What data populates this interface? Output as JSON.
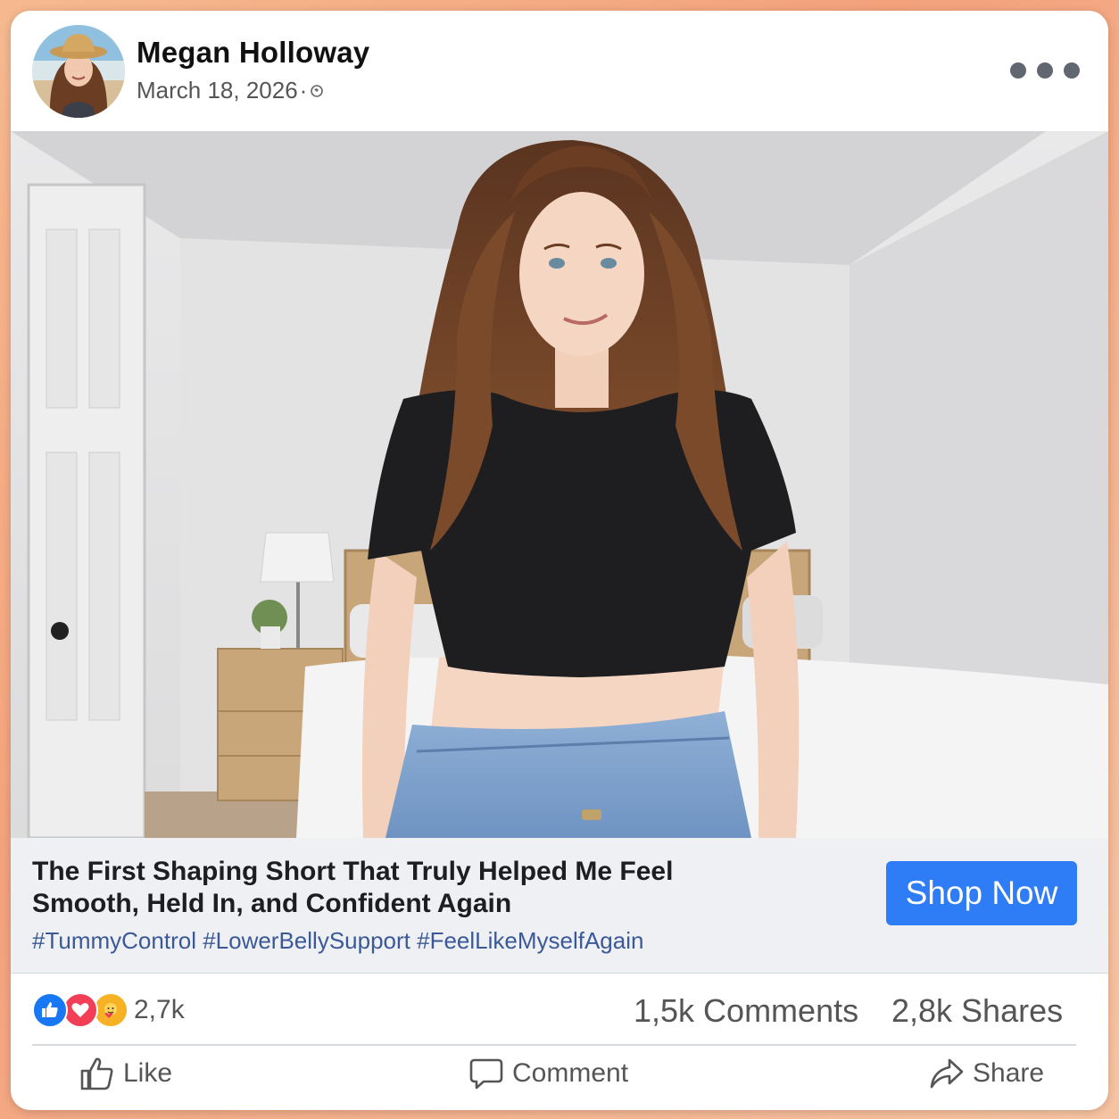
{
  "post": {
    "author": "Megan Holloway",
    "date": "March 18, 2026",
    "date_separator": "·",
    "privacy_icon": "globe-icon",
    "more_icon": "more-options-icon"
  },
  "ad": {
    "headline_line1": "The First Shaping Short That Truly Helped Me Feel",
    "headline_line2": "Smooth, Held In, and Confident Again",
    "hashtags": "#TummyControl #LowerBellySupport #FeelLikeMyselfAgain",
    "cta_label": "Shop Now"
  },
  "stats": {
    "reaction_icons": [
      "like-reaction-icon",
      "love-reaction-icon",
      "care-reaction-icon"
    ],
    "reaction_count": "2,7k",
    "comments": "1,5k Comments",
    "shares": "2,8k Shares"
  },
  "actions": {
    "like_label": "Like",
    "comment_label": "Comment",
    "share_label": "Share"
  },
  "colors": {
    "cta_blue": "#2e7cf6",
    "hashtag_blue": "#3b5998",
    "like_blue": "#1877f2",
    "love_red": "#f33e58",
    "care_yellow": "#f7b125"
  }
}
